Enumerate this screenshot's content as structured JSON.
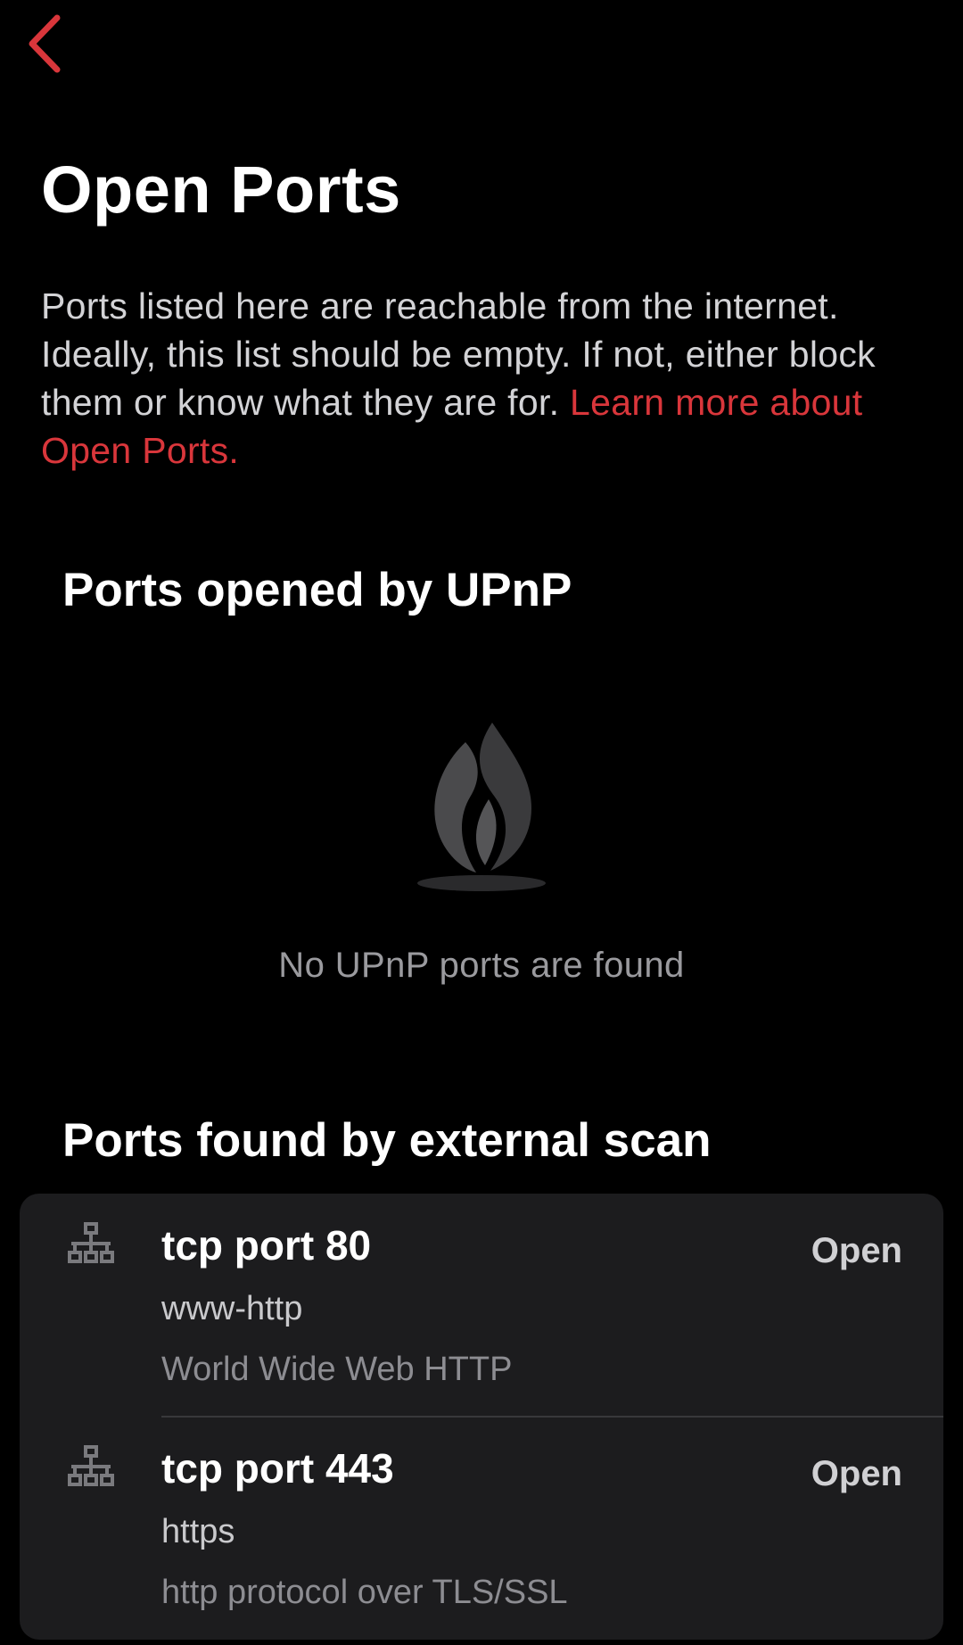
{
  "header": {
    "back_icon": "chevron-left-icon",
    "accent_color": "#d9363b"
  },
  "page": {
    "title": "Open Ports",
    "description": "Ports listed here are reachable from the internet. Ideally, this list should be empty. If not, either block them or know what they are for.",
    "learn_more_link": "Learn more about Open Ports."
  },
  "upnp_section": {
    "heading": "Ports opened by UPnP",
    "empty_icon": "flame-logo-icon",
    "empty_text": "No UPnP ports are found"
  },
  "scan_section": {
    "heading": "Ports found by external scan",
    "ports": [
      {
        "icon": "network-icon",
        "name": "tcp port 80",
        "service": "www-http",
        "description": "World Wide Web HTTP",
        "status": "Open"
      },
      {
        "icon": "network-icon",
        "name": "tcp port 443",
        "service": "https",
        "description": "http protocol over TLS/SSL",
        "status": "Open"
      }
    ]
  }
}
